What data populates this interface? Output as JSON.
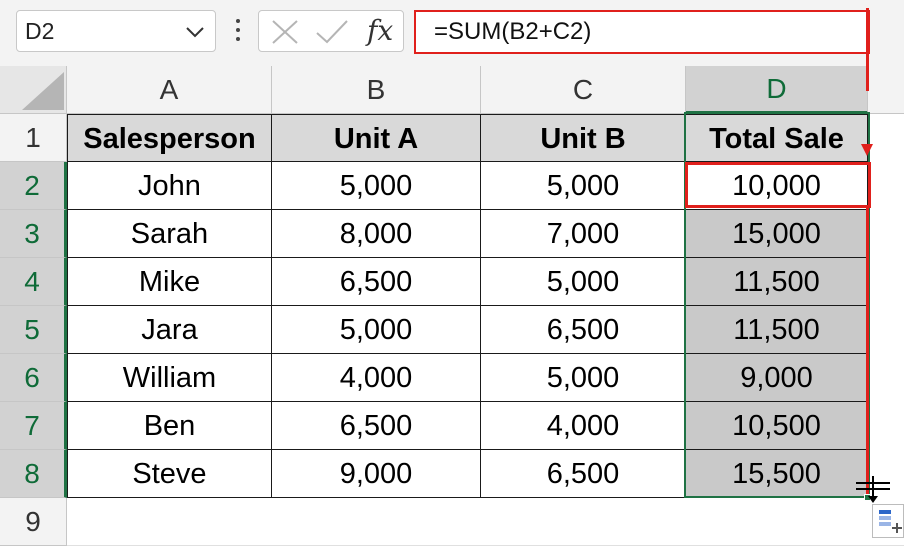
{
  "name_box": {
    "value": "D2"
  },
  "formula_bar": {
    "fx_label": "fx",
    "formula": "=SUM(B2+C2)"
  },
  "columns": [
    "A",
    "B",
    "C",
    "D"
  ],
  "rows": [
    "1",
    "2",
    "3",
    "4",
    "5",
    "6",
    "7",
    "8",
    "9"
  ],
  "table": {
    "headers": [
      "Salesperson",
      "Unit A",
      "Unit B",
      "Total Sale"
    ],
    "data": [
      [
        "John",
        "5,000",
        "5,000",
        "10,000"
      ],
      [
        "Sarah",
        "8,000",
        "7,000",
        "15,000"
      ],
      [
        "Mike",
        "6,500",
        "5,000",
        "11,500"
      ],
      [
        "Jara",
        "5,000",
        "6,500",
        "11,500"
      ],
      [
        "William",
        "4,000",
        "5,000",
        "9,000"
      ],
      [
        "Ben",
        "6,500",
        "4,000",
        "10,500"
      ],
      [
        "Steve",
        "9,000",
        "6,500",
        "15,500"
      ]
    ]
  },
  "colors": {
    "accent_green": "#1f7244",
    "highlight_red": "#e0201c",
    "header_fill": "#d9d9d9",
    "selection_fill": "#c9c9c9"
  },
  "icons": [
    "chevron-down-icon",
    "more-options-icon",
    "cancel-x-icon",
    "enter-check-icon",
    "fx-icon",
    "select-all-icon",
    "resize-cursor-icon",
    "quick-analysis-icon"
  ]
}
